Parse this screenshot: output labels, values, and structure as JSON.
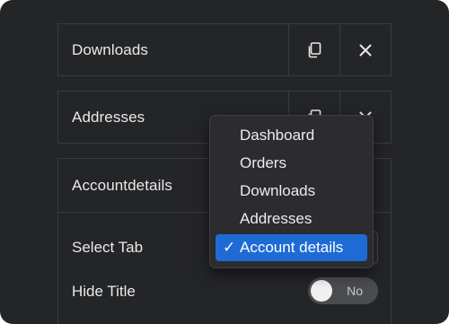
{
  "rows": {
    "downloads": {
      "label": "Downloads"
    },
    "addresses": {
      "label": "Addresses"
    },
    "account": {
      "label": "Accountdetails"
    }
  },
  "fields": {
    "select_tab_label": "Select Tab",
    "hide_title_label": "Hide Title",
    "hide_title_toggle": {
      "state_text": "No",
      "checked": false
    }
  },
  "dropdown": {
    "items": [
      {
        "label": "Dashboard",
        "selected": false
      },
      {
        "label": "Orders",
        "selected": false
      },
      {
        "label": "Downloads",
        "selected": false
      },
      {
        "label": "Addresses",
        "selected": false
      },
      {
        "label": "Account details",
        "selected": true
      }
    ],
    "check_glyph": "✓"
  },
  "icons": {
    "copy": "copy-icon",
    "close": "close-icon",
    "check": "checkmark-icon"
  },
  "colors": {
    "background": "#242527",
    "border": "#3a3b3e",
    "text": "#e9e9ea",
    "menu_background": "#2c2c2f",
    "menu_selected": "#1f6bd6",
    "toggle_track": "#4b4c50"
  }
}
